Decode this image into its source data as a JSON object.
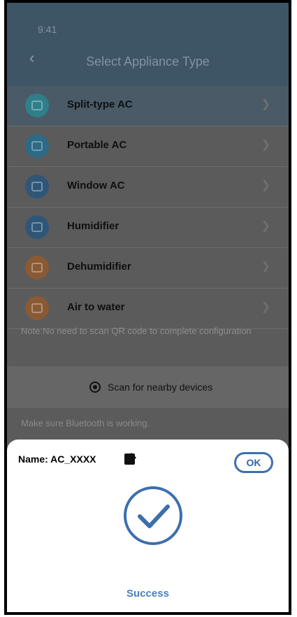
{
  "status_bar": {
    "time": "9:41"
  },
  "header": {
    "title": "Select Appliance Type",
    "back_icon": "back-arrow-icon"
  },
  "appliances": [
    {
      "label": "Split-type AC",
      "icon": "split-ac-icon",
      "color": "#2f7f8b"
    },
    {
      "label": "Portable AC",
      "icon": "portable-ac-icon",
      "color": "#2c6a86"
    },
    {
      "label": "Window AC",
      "icon": "window-ac-icon",
      "color": "#2f5677"
    },
    {
      "label": "Humidifier",
      "icon": "humidifier-icon",
      "color": "#2f5677"
    },
    {
      "label": "Dehumidifier",
      "icon": "dehumidifier-icon",
      "color": "#8a5a35"
    },
    {
      "label": "Air to water",
      "icon": "air-to-water-icon",
      "color": "#8a5a35"
    }
  ],
  "note": "Note:No need to scan QR code to complete configuration",
  "scan": {
    "label": "Scan for nearby devices",
    "icon": "bluetooth-scan-icon"
  },
  "hint": "Make sure Bluetooth is working.",
  "dialog": {
    "name_label": "Name: AC_XXXX",
    "edit_icon": "edit-icon",
    "ok_label": "OK",
    "status": "Success",
    "status_icon": "success-check-icon",
    "accent": "#3b6fae"
  }
}
